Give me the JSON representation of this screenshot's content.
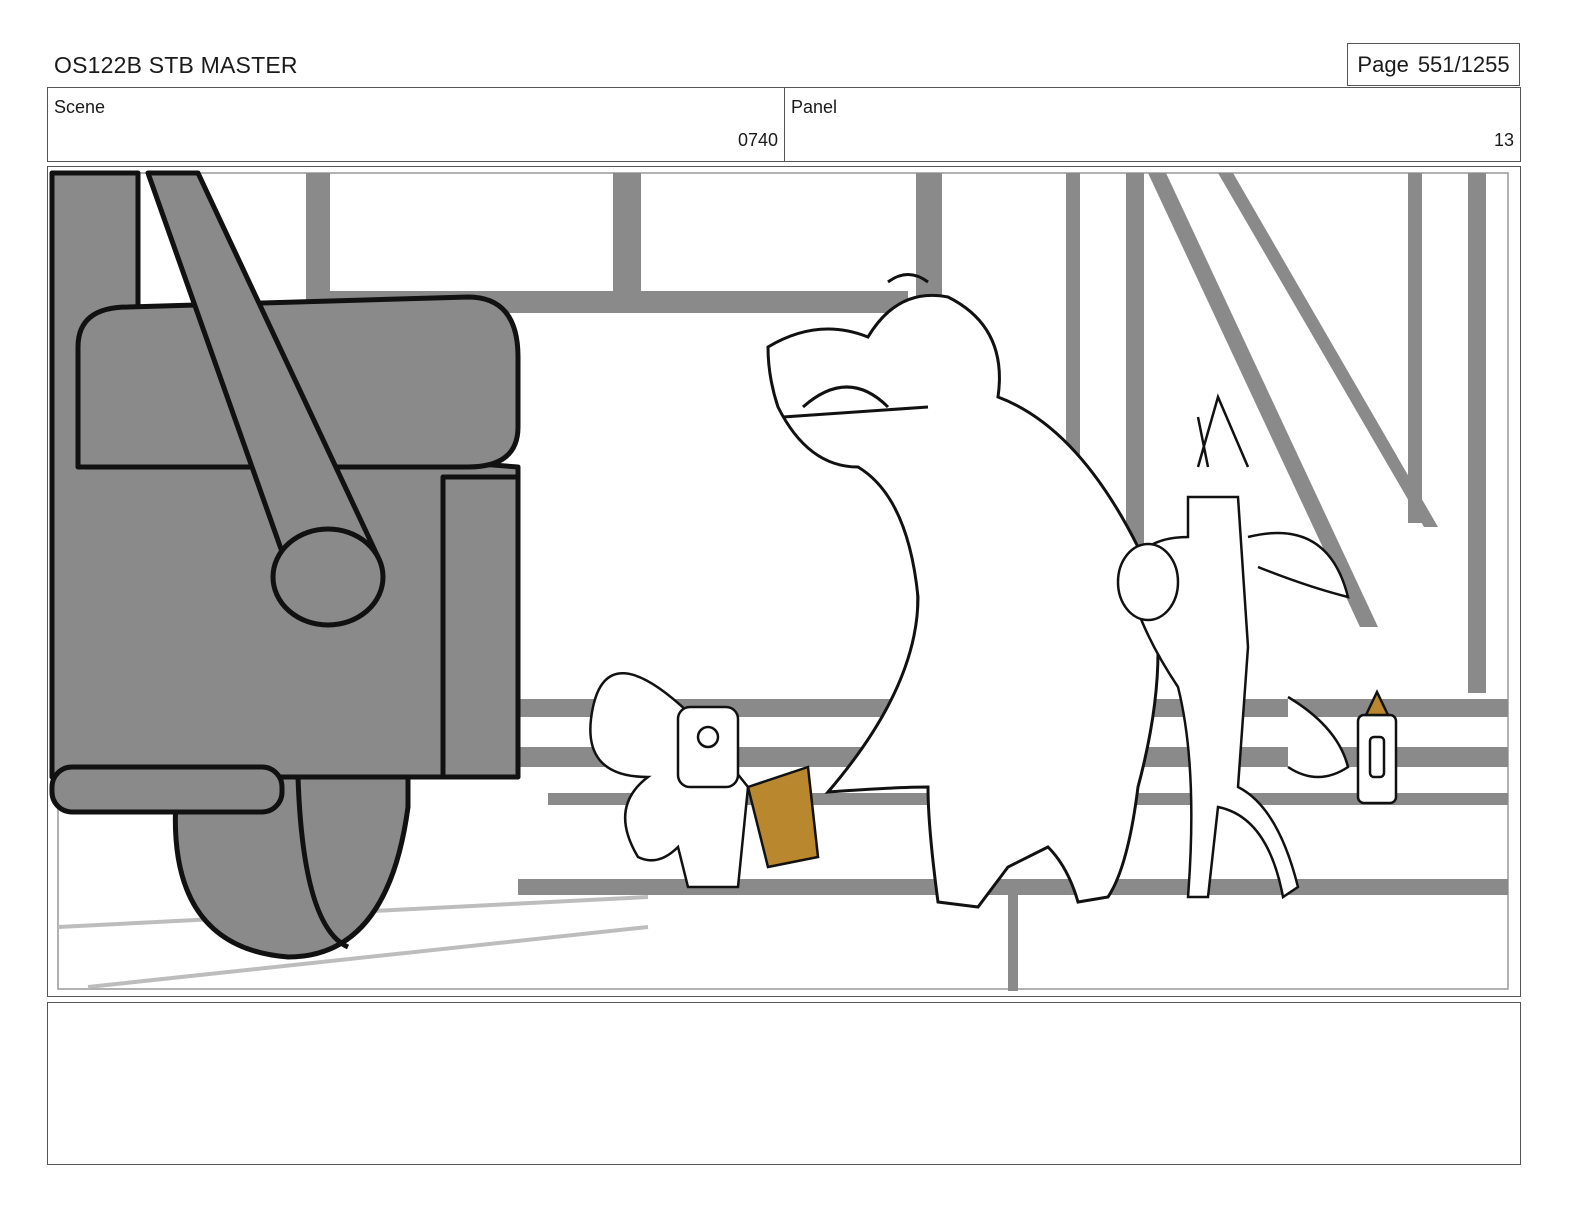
{
  "header": {
    "title": "OS122B STB MASTER",
    "page_label": "Page",
    "page_value": "551/1255"
  },
  "scene": {
    "label": "Scene",
    "value": "0740"
  },
  "panel": {
    "label": "Panel",
    "value": "13"
  },
  "artwork": {
    "description_icon": "storyboard-sketch",
    "colors": {
      "ink": "#111111",
      "tone": "#8a8a8a",
      "light_tone": "#bdbdbd",
      "accent": "#b8872e"
    }
  },
  "notes": {
    "text": ""
  }
}
